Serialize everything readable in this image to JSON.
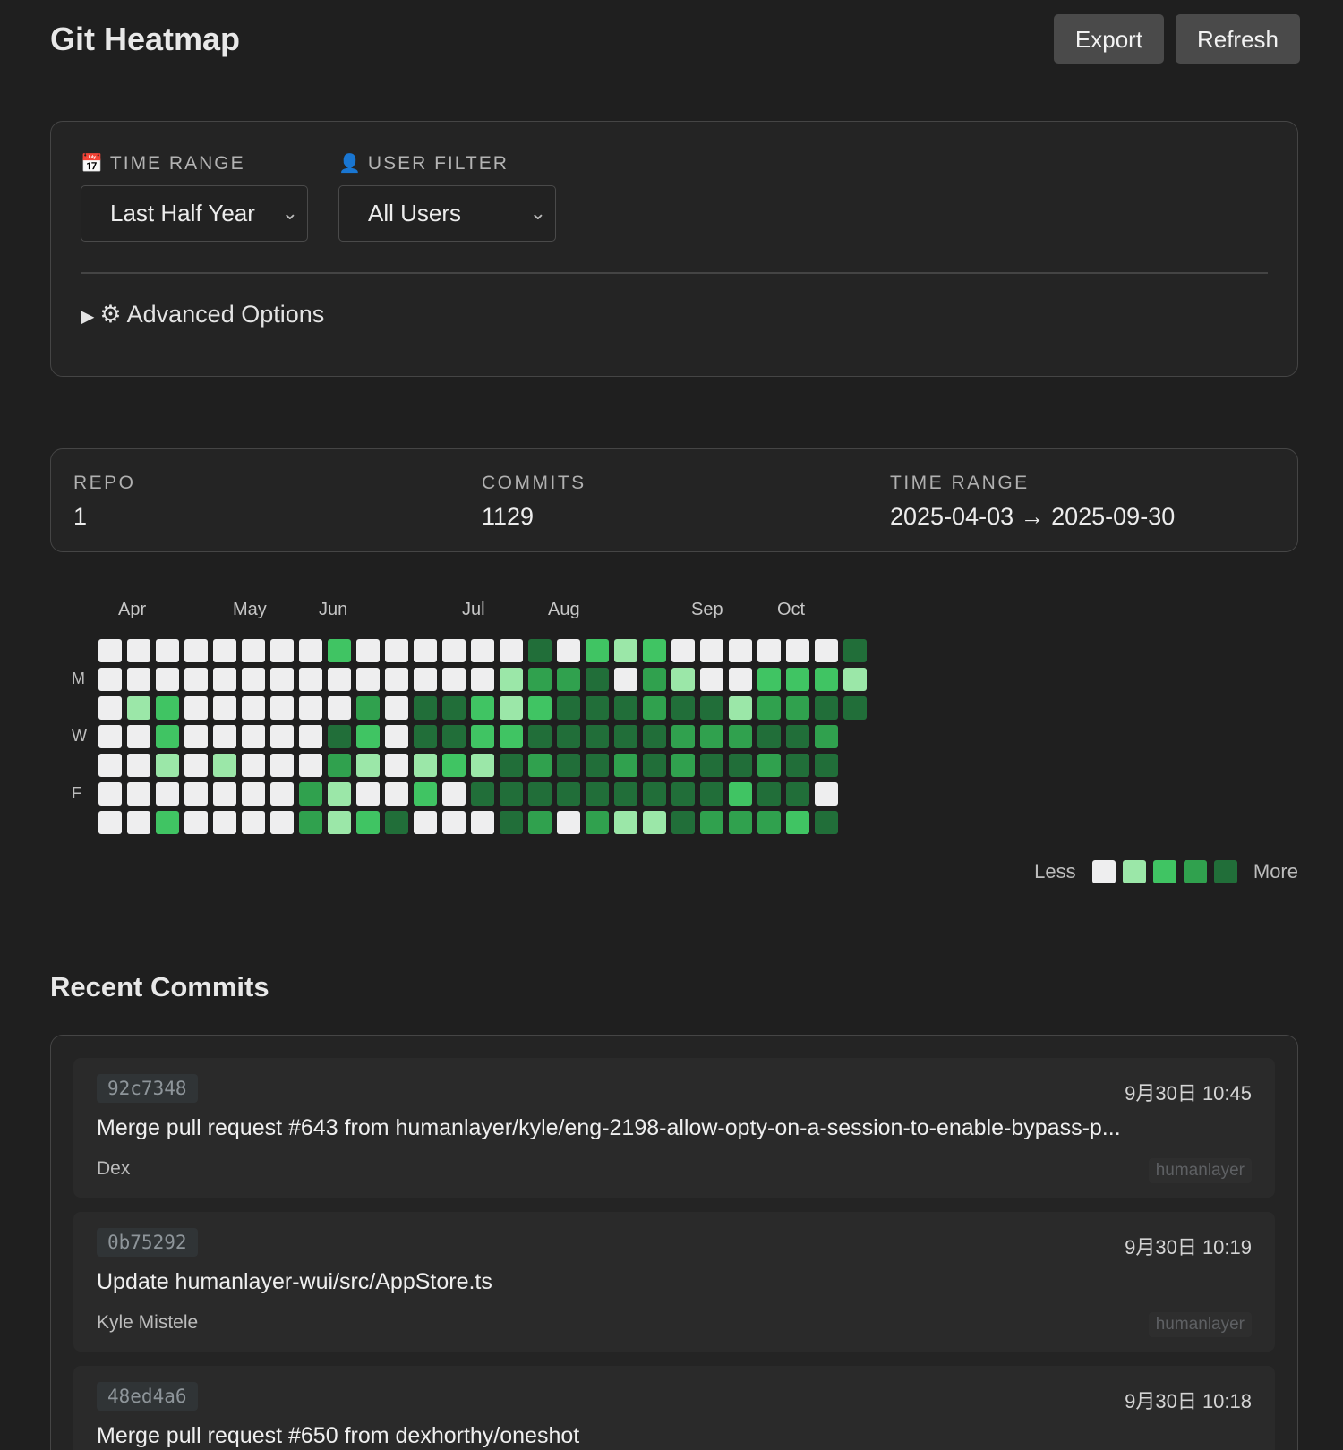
{
  "header": {
    "title": "Git Heatmap",
    "export_label": "Export",
    "refresh_label": "Refresh"
  },
  "filters": {
    "time_range_label": "TIME RANGE",
    "time_range_icon": "calendar-icon",
    "time_range_value": "Last Half Year",
    "user_filter_label": "USER FILTER",
    "user_filter_icon": "user-icon",
    "user_filter_value": "All Users",
    "advanced_label": "Advanced Options",
    "advanced_icon": "gear-icon"
  },
  "stats": [
    {
      "label": "REPO",
      "value": "1"
    },
    {
      "label": "COMMITS",
      "value": "1129"
    },
    {
      "label": "TIME RANGE",
      "value": "2025-04-03 → 2025-09-30"
    }
  ],
  "heatmap": {
    "months": [
      {
        "label": "Apr",
        "week": 1
      },
      {
        "label": "May",
        "week": 5
      },
      {
        "label": "Jun",
        "week": 8
      },
      {
        "label": "Jul",
        "week": 13
      },
      {
        "label": "Aug",
        "week": 16
      },
      {
        "label": "Sep",
        "week": 21
      },
      {
        "label": "Oct",
        "week": 24
      }
    ],
    "day_labels": [
      {
        "label": "M",
        "row": 1
      },
      {
        "label": "W",
        "row": 3
      },
      {
        "label": "F",
        "row": 5
      }
    ],
    "colors": [
      "#eeeeef",
      "#9be7a8",
      "#40c463",
      "#30a14e",
      "#216e39"
    ],
    "levels": [
      [
        0,
        0,
        0,
        0,
        0,
        0,
        0,
        0,
        2,
        0,
        0,
        0,
        0,
        0,
        0,
        4,
        0,
        2,
        1,
        2,
        0,
        0,
        0,
        0,
        0,
        0,
        4
      ],
      [
        0,
        0,
        0,
        0,
        0,
        0,
        0,
        0,
        0,
        0,
        0,
        0,
        0,
        0,
        1,
        3,
        3,
        4,
        0,
        3,
        1,
        0,
        0,
        2,
        2,
        2,
        1
      ],
      [
        0,
        1,
        2,
        0,
        0,
        0,
        0,
        0,
        0,
        3,
        0,
        4,
        4,
        2,
        1,
        2,
        4,
        4,
        4,
        3,
        4,
        4,
        1,
        3,
        3,
        4,
        4
      ],
      [
        0,
        0,
        2,
        0,
        0,
        0,
        0,
        0,
        4,
        2,
        0,
        4,
        4,
        2,
        2,
        4,
        4,
        4,
        4,
        4,
        3,
        3,
        3,
        4,
        4,
        3
      ],
      [
        0,
        0,
        1,
        0,
        1,
        0,
        0,
        0,
        3,
        1,
        0,
        1,
        2,
        1,
        4,
        3,
        4,
        4,
        3,
        4,
        3,
        4,
        4,
        3,
        4,
        4
      ],
      [
        0,
        0,
        0,
        0,
        0,
        0,
        0,
        3,
        1,
        0,
        0,
        2,
        0,
        4,
        4,
        4,
        4,
        4,
        4,
        4,
        4,
        4,
        2,
        4,
        4,
        0
      ],
      [
        0,
        0,
        2,
        0,
        0,
        0,
        0,
        3,
        1,
        2,
        4,
        0,
        0,
        0,
        4,
        3,
        0,
        3,
        1,
        1,
        4,
        3,
        3,
        3,
        2,
        4
      ]
    ],
    "legend_less": "Less",
    "legend_more": "More"
  },
  "recent_commits": {
    "title": "Recent Commits",
    "items": [
      {
        "hash": "92c7348",
        "date": "9月30日 10:45",
        "message": "Merge pull request #643 from humanlayer/kyle/eng-2198-allow-opty-on-a-session-to-enable-bypass-p...",
        "author": "Dex",
        "repo": "humanlayer"
      },
      {
        "hash": "0b75292",
        "date": "9月30日 10:19",
        "message": "Update humanlayer-wui/src/AppStore.ts",
        "author": "Kyle Mistele",
        "repo": "humanlayer"
      },
      {
        "hash": "48ed4a6",
        "date": "9月30日 10:18",
        "message": "Merge pull request #650 from dexhorthy/oneshot",
        "author": "",
        "repo": ""
      }
    ]
  }
}
